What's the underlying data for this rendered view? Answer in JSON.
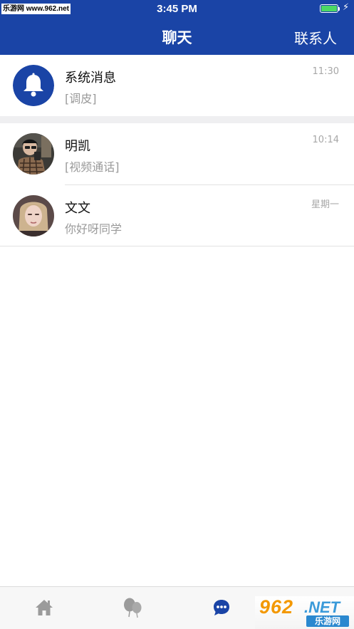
{
  "status_bar": {
    "watermark": "乐游网 www.962.net",
    "time": "3:45 PM",
    "battery_level": 1.0
  },
  "header": {
    "title": "聊天",
    "contacts_label": "联系人"
  },
  "chats": [
    {
      "name": "系统消息",
      "preview": "[调皮]",
      "time": "11:30",
      "avatar": "bell-icon"
    },
    {
      "name": "明凯",
      "preview": "[视频通话]",
      "time": "10:14",
      "avatar": "user-photo"
    },
    {
      "name": "文文",
      "preview": "你好呀同学",
      "time": "星期一",
      "avatar": "user-photo"
    }
  ],
  "tabbar": {
    "tabs": [
      {
        "icon": "home-icon",
        "active": false
      },
      {
        "icon": "balloons-icon",
        "active": false
      },
      {
        "icon": "chat-bubble-icon",
        "active": true
      }
    ]
  },
  "watermark_logo": {
    "main": "962",
    "net": ".NET",
    "sub": "乐游网"
  },
  "colors": {
    "brand_blue": "#1a44a6",
    "battery_green": "#4cd964",
    "muted_text": "#9a9a9a",
    "tab_inactive": "#9b9b9b",
    "watermark_orange": "#f39800"
  }
}
